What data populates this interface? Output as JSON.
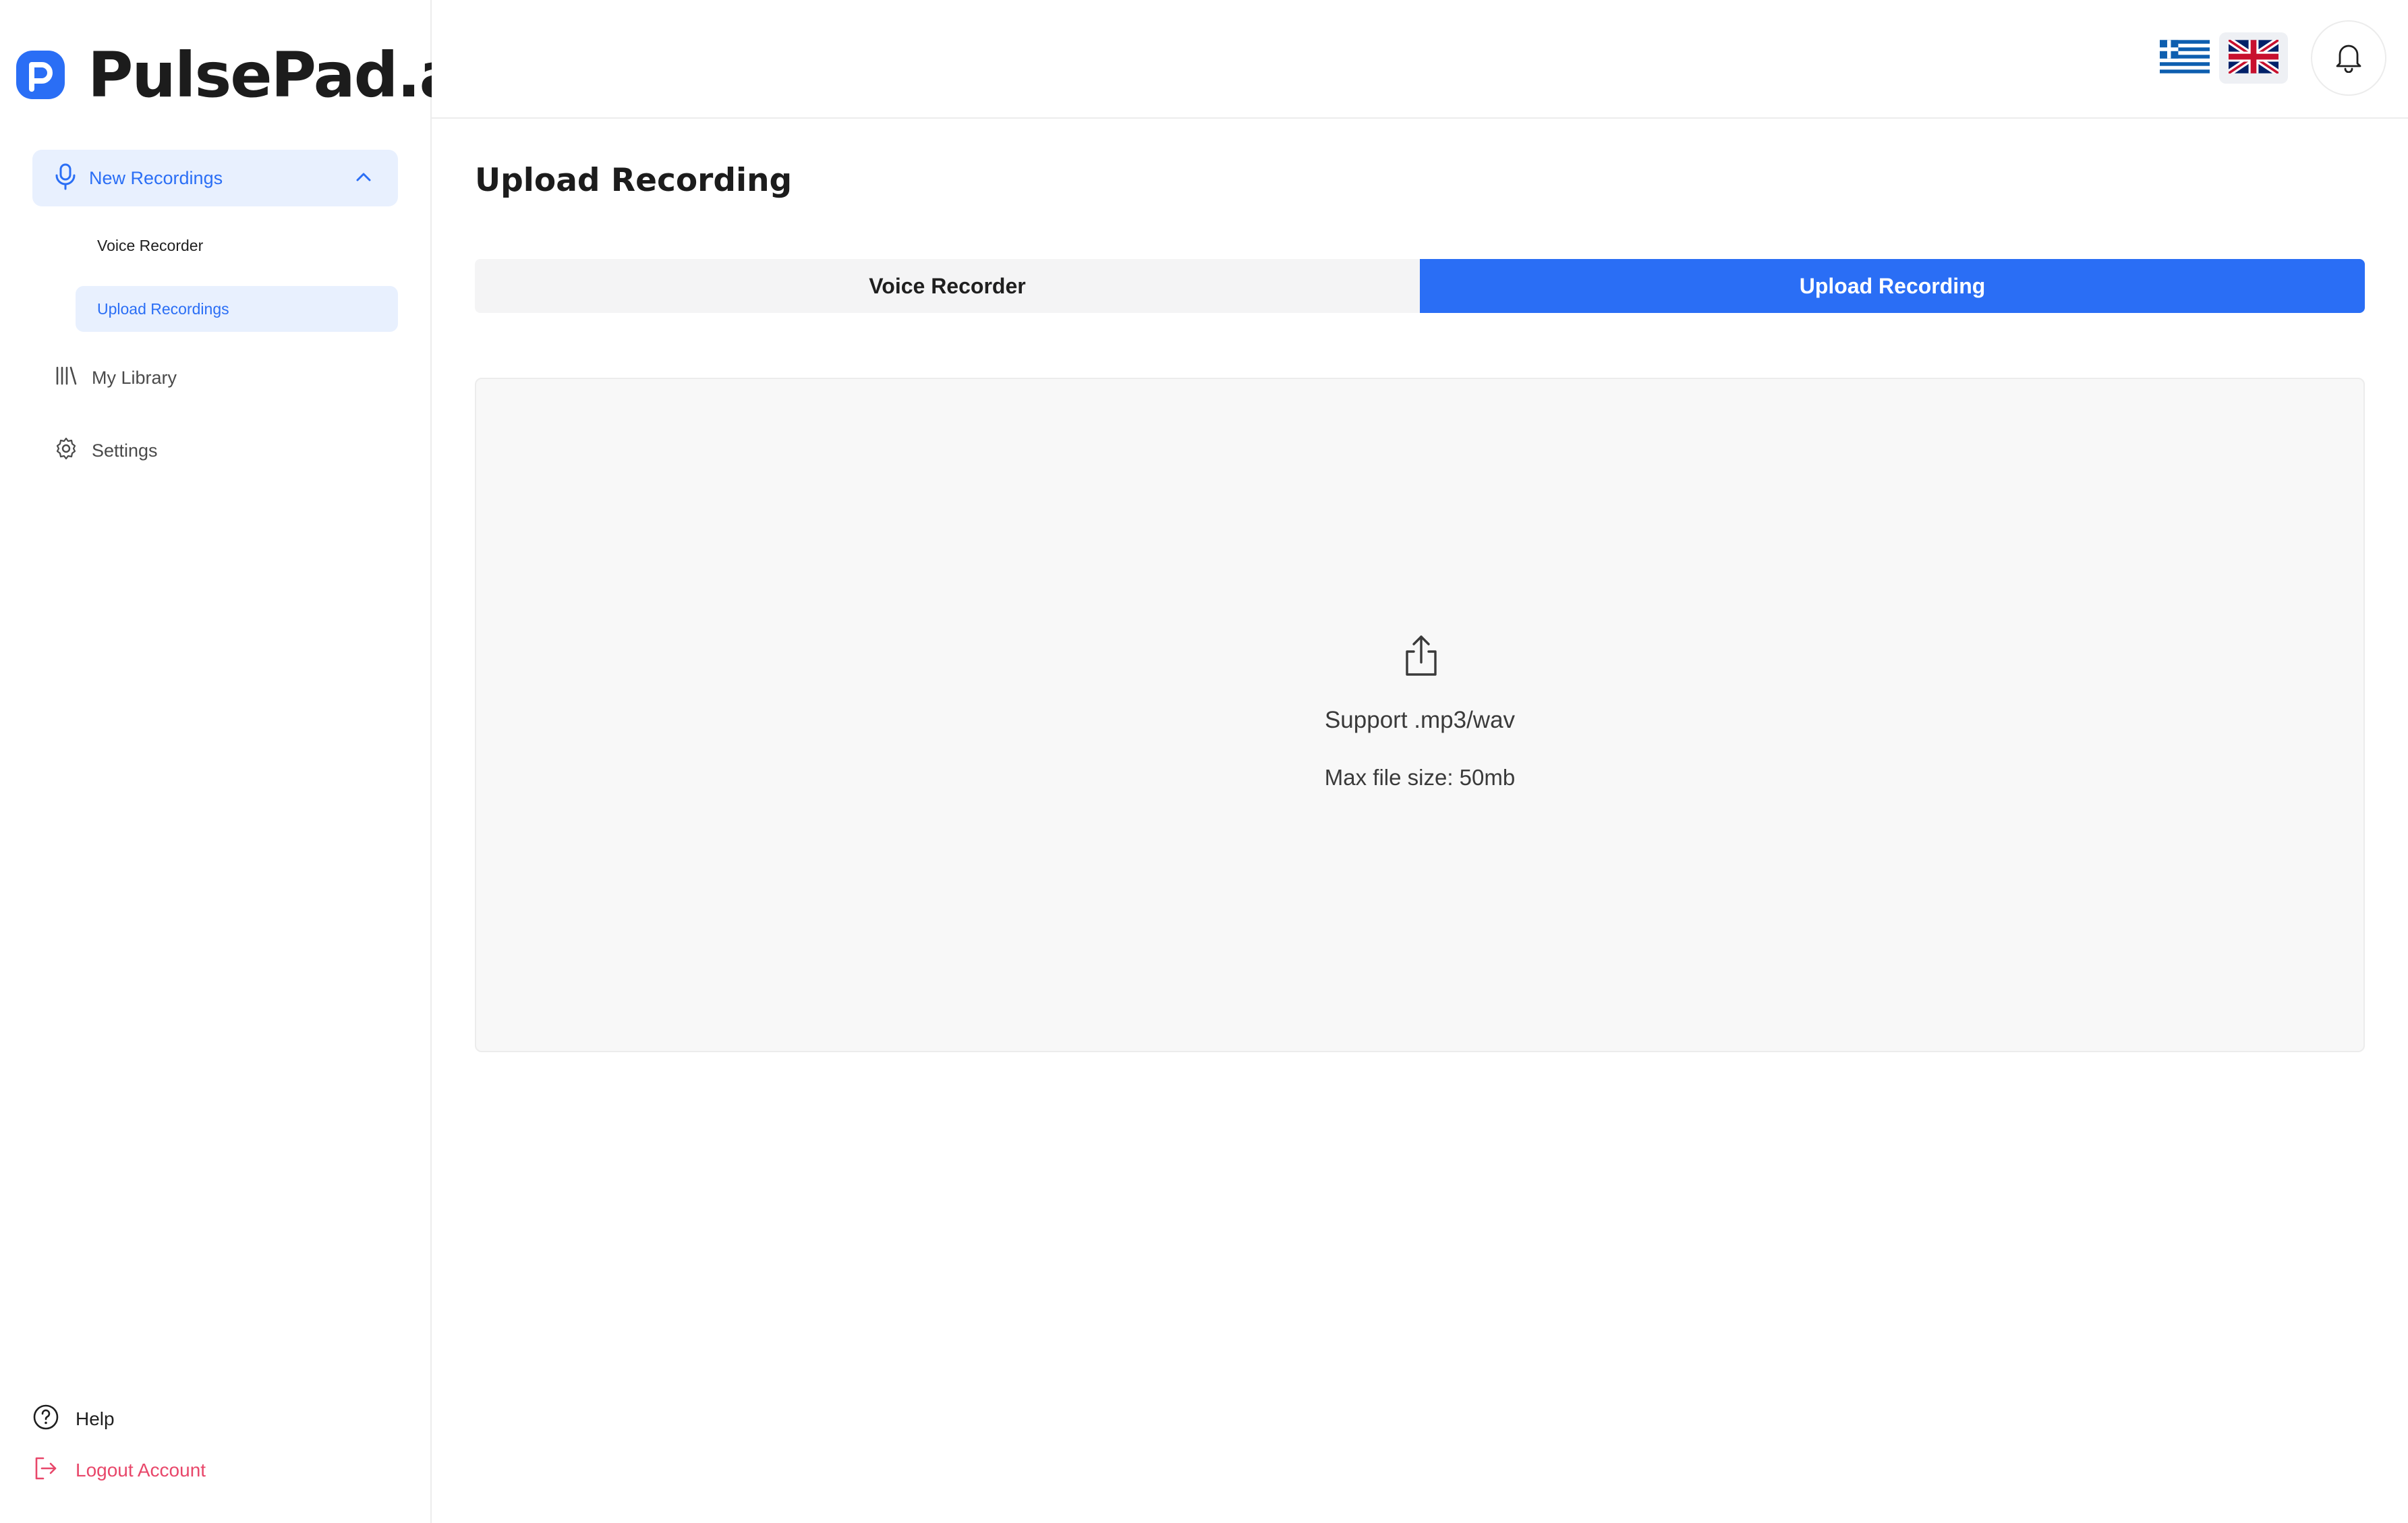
{
  "brand": {
    "name": "PulsePad.ai"
  },
  "sidebar": {
    "group": {
      "label": "New Recordings",
      "expanded": true
    },
    "sub_items": [
      {
        "label": "Voice Recorder",
        "active": false
      },
      {
        "label": "Upload Recordings",
        "active": true
      }
    ],
    "items": [
      {
        "label": "My Library",
        "icon": "library-icon"
      },
      {
        "label": "Settings",
        "icon": "gear-icon"
      }
    ],
    "footer": {
      "help_label": "Help",
      "logout_label": "Logout Account"
    }
  },
  "header": {
    "languages": [
      {
        "code": "el",
        "icon": "greek-flag-icon",
        "selected": false
      },
      {
        "code": "en",
        "icon": "uk-flag-icon",
        "selected": true
      }
    ],
    "notifications_icon": "bell-icon"
  },
  "main": {
    "title": "Upload Recording",
    "tabs": [
      {
        "label": "Voice Recorder",
        "active": false
      },
      {
        "label": "Upload Recording",
        "active": true
      }
    ],
    "dropzone": {
      "icon": "upload-icon",
      "supported_formats": "Support .mp3/wav",
      "max_size": "Max file size: 50mb"
    }
  },
  "colors": {
    "accent": "#2a6ef5",
    "accent_soft": "#e8f0fe",
    "danger": "#e8476a"
  }
}
